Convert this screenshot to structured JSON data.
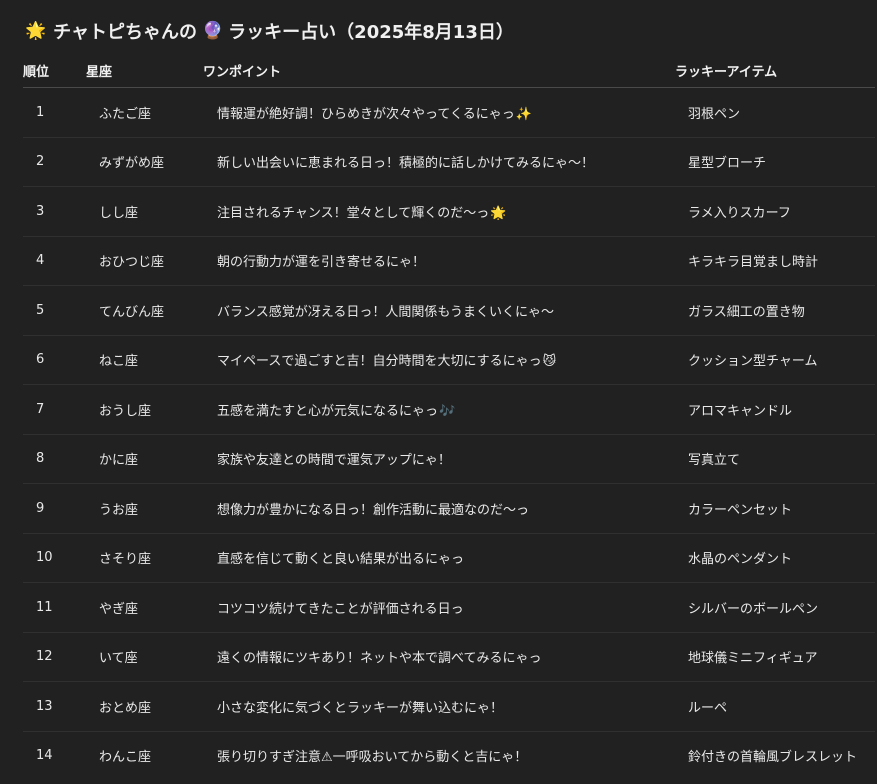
{
  "title": {
    "sun_emoji": "🌟",
    "text_before": "チャトピちゃんの",
    "ball_emoji": "🔮",
    "text_after": "ラッキー占い（2025年8月13日）"
  },
  "table": {
    "headers": {
      "rank": "順位",
      "sign": "星座",
      "tip": "ワンポイント",
      "item": "ラッキーアイテム"
    },
    "rows": [
      {
        "rank": "1",
        "sign": "ふたご座",
        "tip": "情報運が絶好調！ひらめきが次々やってくるにゃっ",
        "tip_emoji": "✨",
        "item": "羽根ペン"
      },
      {
        "rank": "2",
        "sign": "みずがめ座",
        "tip": "新しい出会いに恵まれる日っ！積極的に話しかけてみるにゃ〜！",
        "tip_emoji": "",
        "item": "星型ブローチ"
      },
      {
        "rank": "3",
        "sign": "しし座",
        "tip": "注目されるチャンス！堂々として輝くのだ〜っ",
        "tip_emoji": "🌟",
        "item": "ラメ入りスカーフ"
      },
      {
        "rank": "4",
        "sign": "おひつじ座",
        "tip": "朝の行動力が運を引き寄せるにゃ！",
        "tip_emoji": "",
        "item": "キラキラ目覚まし時計"
      },
      {
        "rank": "5",
        "sign": "てんびん座",
        "tip": "バランス感覚が冴える日っ！人間関係もうまくいくにゃ〜",
        "tip_emoji": "",
        "item": "ガラス細工の置き物"
      },
      {
        "rank": "6",
        "sign": "ねこ座",
        "tip": "マイペースで過ごすと吉！自分時間を大切にするにゃっ",
        "tip_emoji": "😼",
        "item": "クッション型チャーム"
      },
      {
        "rank": "7",
        "sign": "おうし座",
        "tip": "五感を満たすと心が元気になるにゃっ",
        "tip_emoji": "🎶",
        "item": "アロマキャンドル"
      },
      {
        "rank": "8",
        "sign": "かに座",
        "tip": "家族や友達との時間で運気アップにゃ！",
        "tip_emoji": "",
        "item": "写真立て"
      },
      {
        "rank": "9",
        "sign": "うお座",
        "tip": "想像力が豊かになる日っ！創作活動に最適なのだ〜っ",
        "tip_emoji": "",
        "item": "カラーペンセット"
      },
      {
        "rank": "10",
        "sign": "さそり座",
        "tip": "直感を信じて動くと良い結果が出るにゃっ",
        "tip_emoji": "",
        "item": "水晶のペンダント"
      },
      {
        "rank": "11",
        "sign": "やぎ座",
        "tip": "コツコツ続けてきたことが評価される日っ",
        "tip_emoji": "",
        "item": "シルバーのボールペン"
      },
      {
        "rank": "12",
        "sign": "いて座",
        "tip": "遠くの情報にツキあり！ネットや本で調べてみるにゃっ",
        "tip_emoji": "",
        "item": "地球儀ミニフィギュア"
      },
      {
        "rank": "13",
        "sign": "おとめ座",
        "tip": "小さな変化に気づくとラッキーが舞い込むにゃ！",
        "tip_emoji": "",
        "item": "ルーペ"
      },
      {
        "rank": "14",
        "sign": "わんこ座",
        "tip": "張り切りすぎ注意⚠一呼吸おいてから動くと吉にゃ！",
        "tip_emoji": "",
        "item": "鈴付きの首輪風ブレスレット"
      }
    ]
  }
}
